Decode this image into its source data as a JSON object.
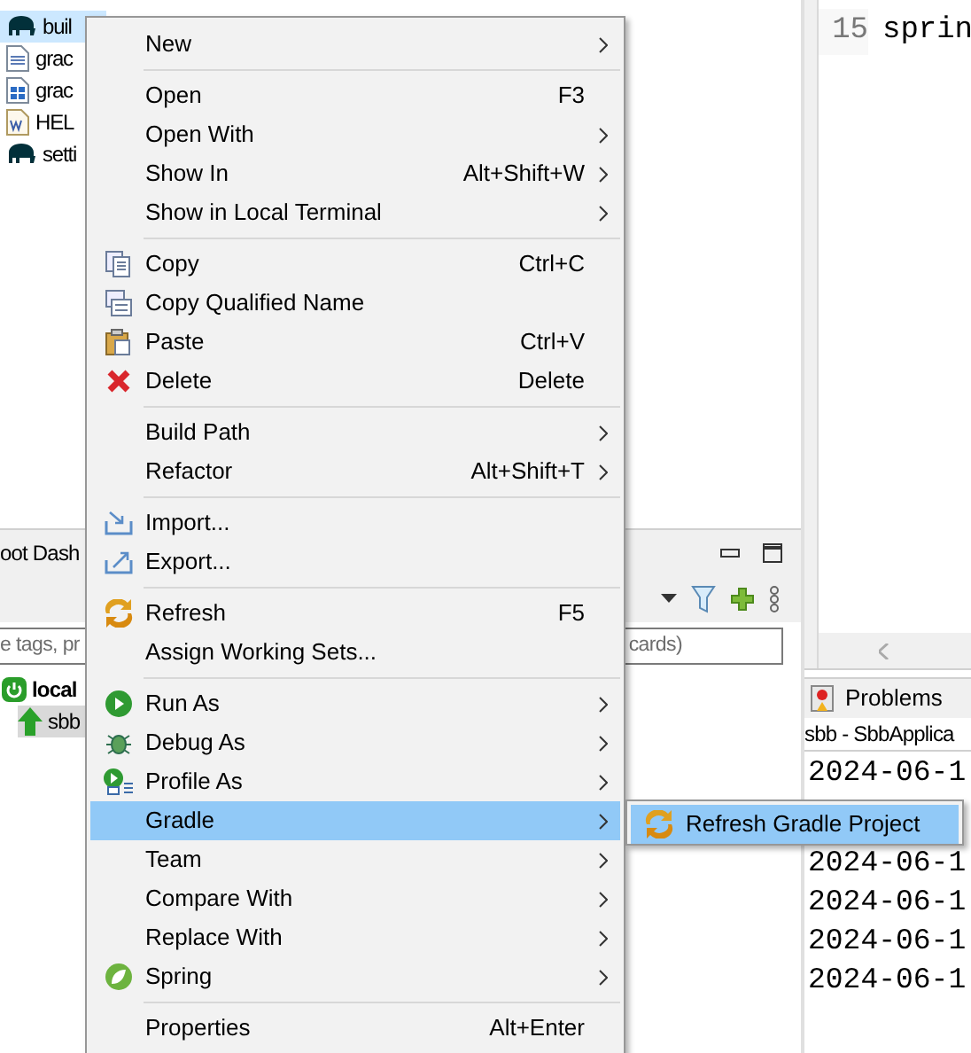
{
  "project_tree": [
    {
      "label": "buil",
      "kind": "elephant",
      "selected": true
    },
    {
      "label": "grac",
      "kind": "text-file",
      "selected": false
    },
    {
      "label": "grac",
      "kind": "grid-file",
      "selected": false
    },
    {
      "label": "HEL",
      "kind": "word-file",
      "selected": false
    },
    {
      "label": "setti",
      "kind": "elephant",
      "selected": false
    }
  ],
  "dashboard": {
    "tab": "oot Dash",
    "search": {
      "placeholder_left": "e tags, pr",
      "placeholder_right": "cards)"
    },
    "tree": [
      {
        "label": "local",
        "kind": "power",
        "selected": false,
        "children": [
          {
            "label": "sbb",
            "kind": "up-arrow",
            "selected": true
          }
        ]
      }
    ]
  },
  "editor": {
    "lines": [
      {
        "number": "15",
        "text": "sprin"
      }
    ]
  },
  "console": {
    "tab": "Problems",
    "title": "sbb - SbbApplica",
    "lines": [
      "2024-06-1",
      "2024-06-1",
      "2024-06-1",
      "2024-06-1",
      "2024-06-1"
    ]
  },
  "context_menu": {
    "groups": [
      [
        {
          "label": "New",
          "submenu": true,
          "selected": false
        }
      ],
      [
        {
          "label": "Open",
          "shortcut": "F3",
          "selected": false
        },
        {
          "label": "Open With",
          "submenu": true,
          "selected": false
        },
        {
          "label": "Show In",
          "shortcut": "Alt+Shift+W",
          "submenu": true,
          "selected": false
        },
        {
          "label": "Show in Local Terminal",
          "submenu": true,
          "selected": false
        }
      ],
      [
        {
          "label": "Copy",
          "shortcut": "Ctrl+C",
          "kind": "copy",
          "selected": false
        },
        {
          "label": "Copy Qualified Name",
          "kind": "copy-name",
          "selected": false
        },
        {
          "label": "Paste",
          "shortcut": "Ctrl+V",
          "kind": "paste",
          "selected": false
        },
        {
          "label": "Delete",
          "shortcut": "Delete",
          "kind": "delete",
          "selected": false
        }
      ],
      [
        {
          "label": "Build Path",
          "submenu": true,
          "selected": false
        },
        {
          "label": "Refactor",
          "shortcut": "Alt+Shift+T",
          "submenu": true,
          "selected": false
        }
      ],
      [
        {
          "label": "Import...",
          "kind": "import",
          "selected": false
        },
        {
          "label": "Export...",
          "kind": "export",
          "selected": false
        }
      ],
      [
        {
          "label": "Refresh",
          "shortcut": "F5",
          "kind": "refresh",
          "selected": false
        },
        {
          "label": "Assign Working Sets...",
          "selected": false
        }
      ],
      [
        {
          "label": "Run As",
          "kind": "run",
          "submenu": true,
          "selected": false
        },
        {
          "label": "Debug As",
          "kind": "bug",
          "submenu": true,
          "selected": false
        },
        {
          "label": "Profile As",
          "kind": "profile",
          "submenu": true,
          "selected": false
        },
        {
          "label": "Gradle",
          "submenu": true,
          "selected": true
        },
        {
          "label": "Team",
          "submenu": true,
          "selected": false
        },
        {
          "label": "Compare With",
          "submenu": true,
          "selected": false
        },
        {
          "label": "Replace With",
          "submenu": true,
          "selected": false
        },
        {
          "label": "Spring",
          "kind": "leaf",
          "submenu": true,
          "selected": false
        }
      ],
      [
        {
          "label": "Properties",
          "shortcut": "Alt+Enter",
          "selected": false
        }
      ]
    ]
  },
  "submenu": {
    "items": [
      {
        "label": "Refresh Gradle Project",
        "kind": "refresh",
        "selected": true
      }
    ]
  }
}
